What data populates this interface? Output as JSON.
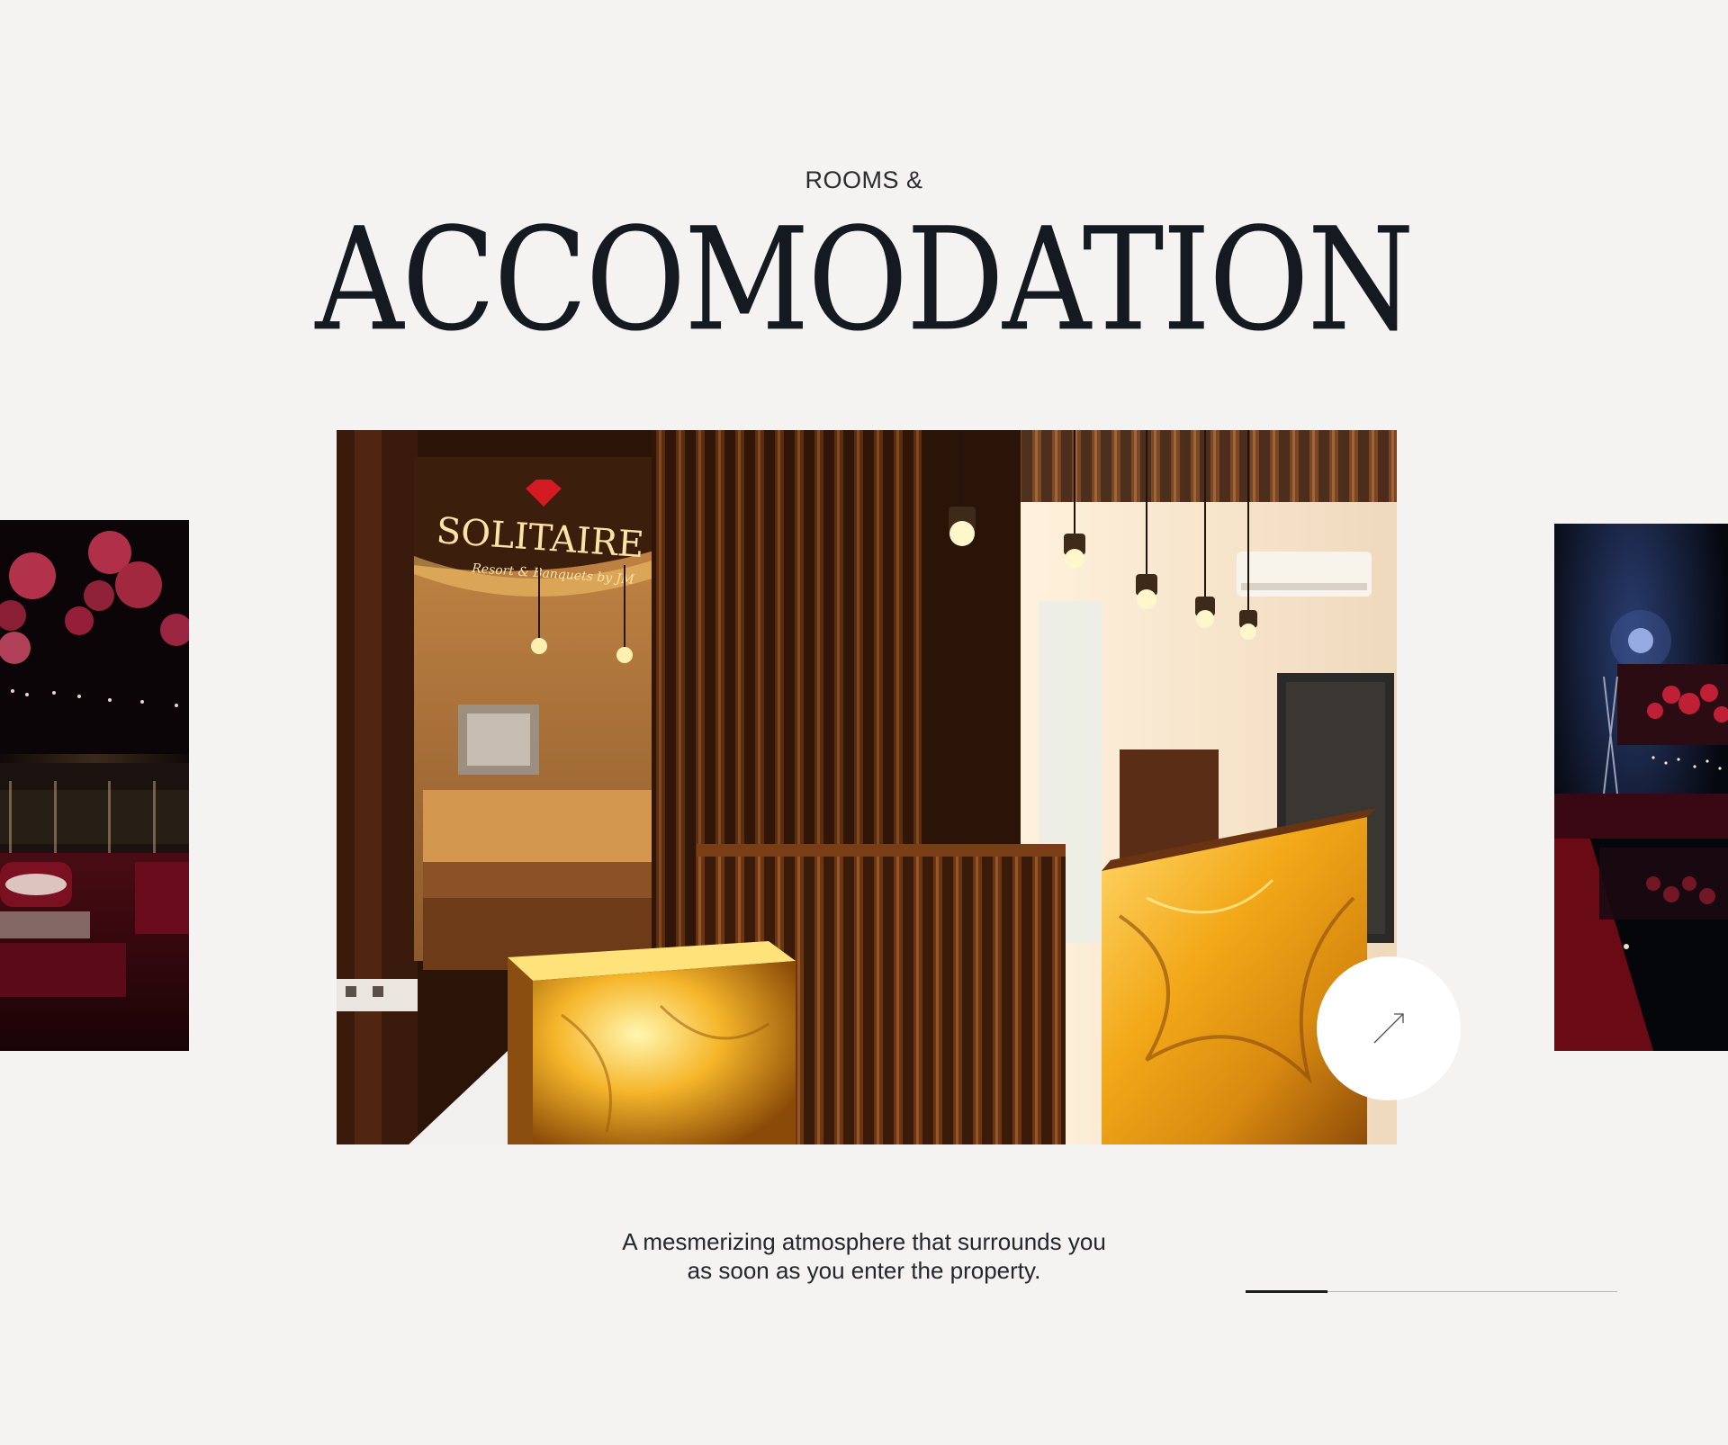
{
  "section": {
    "eyebrow": "ROOMS &",
    "title": "ACCOMODATION"
  },
  "carousel": {
    "main_slide": {
      "sign_title": "SOLITAIRE",
      "sign_subtitle": "Resort & Banquets by JM"
    },
    "cta_icon": "arrow-up-right-icon",
    "progress": 0.22
  },
  "caption": {
    "line1": "A mesmerizing atmosphere that surrounds you",
    "line2": "as soon as you enter the property."
  },
  "colors": {
    "background": "#f5f3f1",
    "heading": "#151a21",
    "text": "#23262b"
  }
}
